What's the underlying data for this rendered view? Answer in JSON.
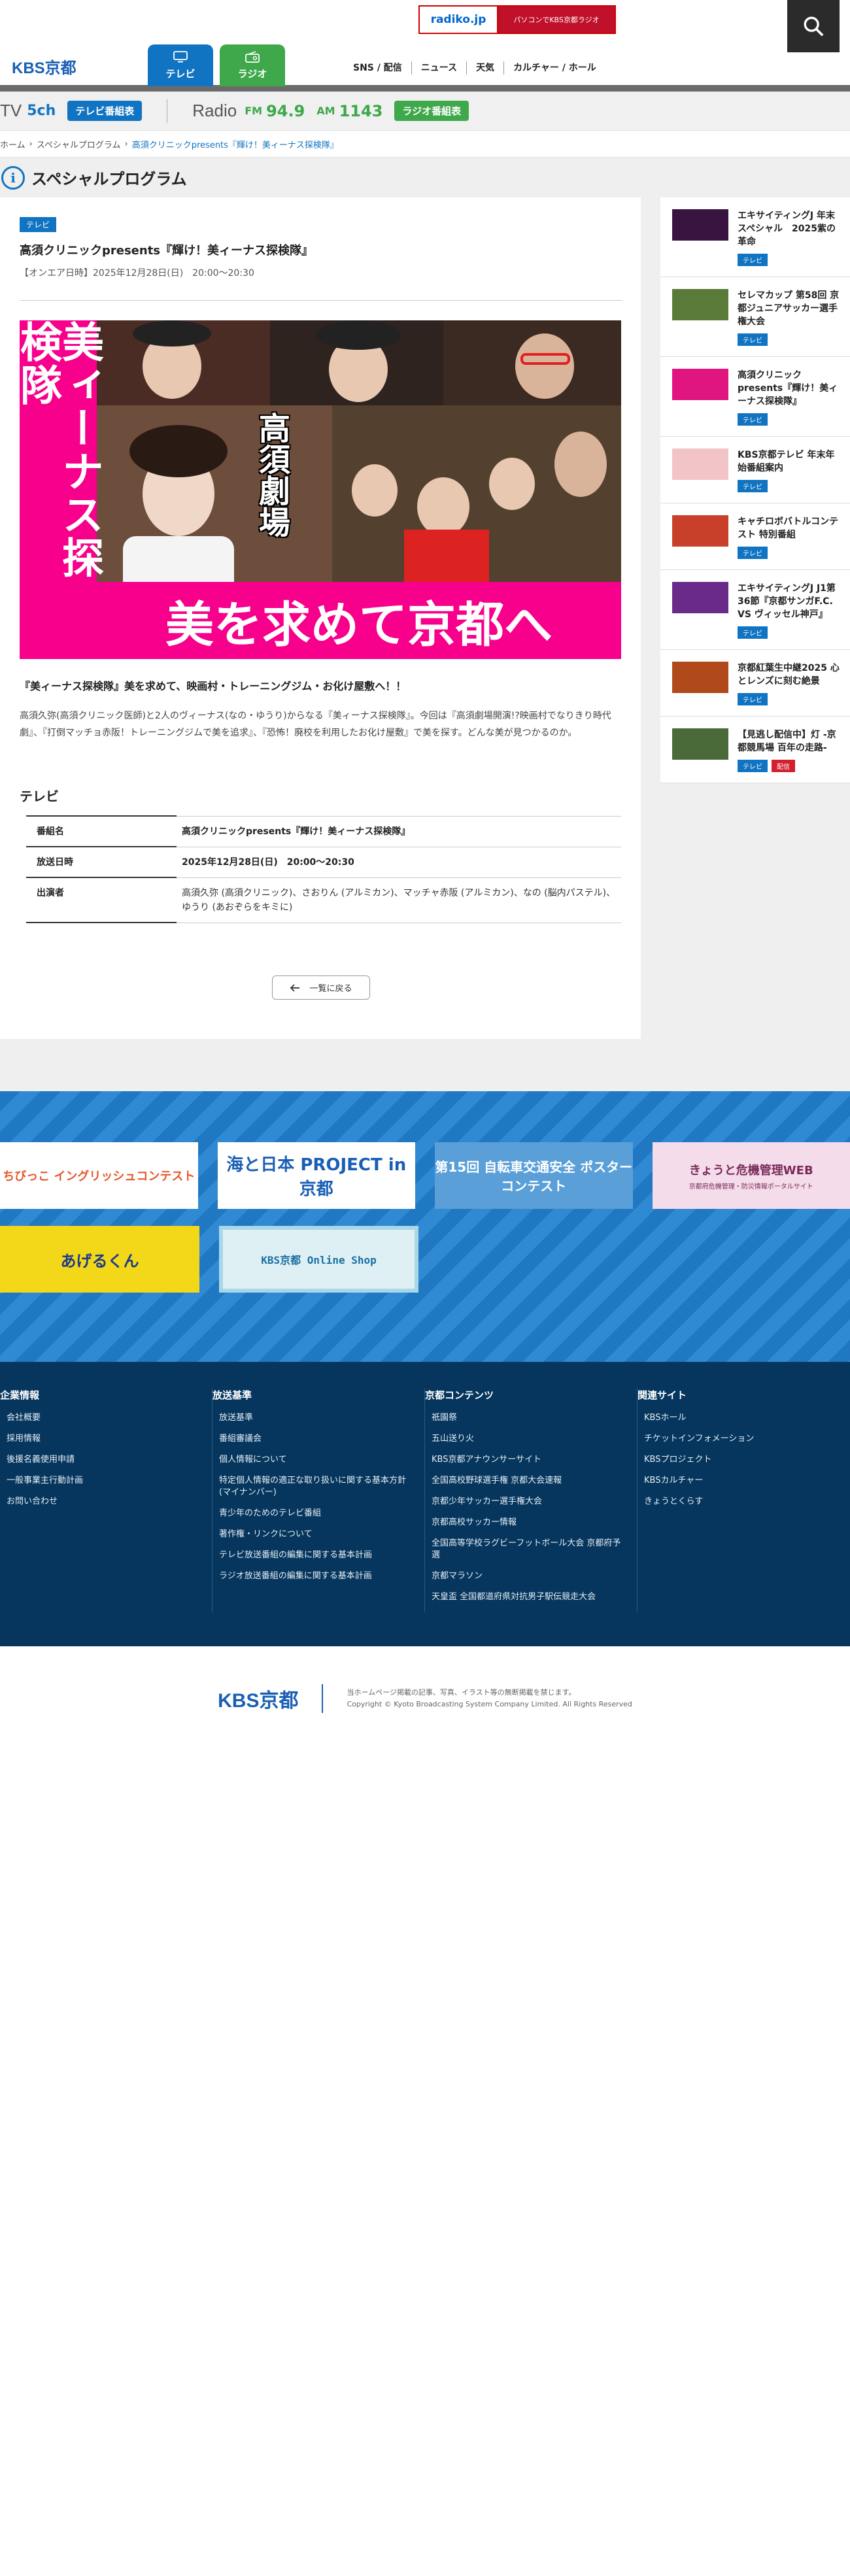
{
  "header": {
    "logo": "KBS京都",
    "radiko_logo": "radiko.jp",
    "radiko_text": "パソコンでKBS京都ラジオ",
    "tab_tv": "テレビ",
    "tab_radio": "ラジオ",
    "nav": [
      "SNS / 配信",
      "ニュース",
      "天気",
      "カルチャー / ホール"
    ]
  },
  "channel": {
    "tv_label": "TV",
    "tv_num": "5ch",
    "tv_btn": "テレビ番組表",
    "radio_label": "Radio",
    "fm": "FM",
    "fm_num": "94.9",
    "am": "AM",
    "am_num": "1143",
    "radio_btn": "ラジオ番組表"
  },
  "breadcrumb": [
    "ホーム",
    "スペシャルプログラム",
    "高須クリニックpresents『輝け！美ィーナス探検隊』"
  ],
  "section_title": "スペシャルプログラム",
  "article": {
    "tag": "テレビ",
    "title": "高須クリニックpresents『輝け！美ィーナス探検隊』",
    "date": "【オンエア日時】2025年12月28日(日)　20:00〜20:30",
    "hero_vertical": "美ィーナス探検隊",
    "hero_bottom": "美を求めて京都へ",
    "hero_seal": "高須劇場",
    "lead": "『美ィーナス探検隊』美を求めて、映画村・トレーニングジム・お化け屋敷へ！！",
    "desc": "高須久弥(高須クリニック医師)と2人のヴィーナス(なの・ゆうり)からなる『美ィーナス探検隊』。今回は『高須劇場開演!?映画村でなりきり時代劇』、『打倒マッチョ赤阪！トレーニングジムで美を追求』、『恐怖！廃校を利用したお化け屋敷』で美を探す。どんな美が見つかるのか。",
    "section": "テレビ",
    "table": [
      {
        "k": "番組名",
        "v": "高須クリニックpresents『輝け！美ィーナス探検隊』"
      },
      {
        "k": "放送日時",
        "v": "2025年12月28日(日)　20:00〜20:30"
      },
      {
        "k": "出演者",
        "v": "高須久弥 (高須クリニック)、さおりん (アルミカン)、マッチャ赤阪 (アルミカン)、なの (脳内パステル)、ゆうり (あおぞらをキミに)"
      }
    ],
    "back": "一覧に戻る"
  },
  "sidebar": [
    {
      "title": "エキサイティングJ 年末スペシャル　2025紫の革命",
      "tags": [
        "テレビ"
      ],
      "color": "#3a1440"
    },
    {
      "title": "セレマカップ 第58回 京都ジュニアサッカー選手権大会",
      "tags": [
        "テレビ"
      ],
      "color": "#5a7a3a"
    },
    {
      "title": "高須クリニックpresents『輝け！美ィーナス探検隊』",
      "tags": [
        "テレビ"
      ],
      "color": "#e0157f"
    },
    {
      "title": "KBS京都テレビ 年末年始番組案内",
      "tags": [
        "テレビ"
      ],
      "color": "#f2c4c8"
    },
    {
      "title": "キャチロボバトルコンテスト 特別番組",
      "tags": [
        "テレビ"
      ],
      "color": "#c8402a"
    },
    {
      "title": "エキサイティングJ J1第36節『京都サンガF.C. VS ヴィッセル神戸』",
      "tags": [
        "テレビ"
      ],
      "color": "#6a2a8a"
    },
    {
      "title": "京都紅葉生中継2025 心とレンズに刻む絶景",
      "tags": [
        "テレビ"
      ],
      "color": "#b04a1a"
    },
    {
      "title": "【見逃し配信中】灯 -京都競馬場 百年の走路-",
      "tags": [
        "テレビ",
        "配信"
      ],
      "color": "#4a6a3a"
    }
  ],
  "banners": {
    "b1": "ちびっこ イングリッシュコンテスト",
    "b2": "海と日本 PROJECT in 京都",
    "b3": "第15回 自転車交通安全 ポスターコンテスト",
    "b4": "きょうと危機管理WEB",
    "b4_sub": "京都府危機管理・防災情報ポータルサイト",
    "b5": "あげるくん",
    "b6": "KBS京都 Online Shop"
  },
  "footer_links": [
    {
      "head": "企業情報",
      "items": [
        "会社概要",
        "採用情報",
        "後援名義使用申請",
        "一般事業主行動計画",
        "お問い合わせ"
      ]
    },
    {
      "head": "放送基準",
      "items": [
        "放送基準",
        "番組審議会",
        "個人情報について",
        "特定個人情報の適正な取り扱いに関する基本方針(マイナンバー)",
        "青少年のためのテレビ番組",
        "著作権・リンクについて",
        "テレビ放送番組の編集に関する基本計画",
        "ラジオ放送番組の編集に関する基本計画"
      ]
    },
    {
      "head": "京都コンテンツ",
      "items": [
        "祇園祭",
        "五山送り火",
        "KBS京都アナウンサーサイト",
        "全国高校野球選手権 京都大会速報",
        "京都少年サッカー選手権大会",
        "京都高校サッカー情報",
        "全国高等学校ラグビーフットボール大会 京都府予選",
        "京都マラソン",
        "天皇盃 全国都道府県対抗男子駅伝競走大会"
      ]
    },
    {
      "head": "関連サイト",
      "items": [
        "KBSホール",
        "チケットインフォメーション",
        "KBSプロジェクト",
        "KBSカルチャー",
        "きょうとくらす"
      ]
    }
  ],
  "footer": {
    "logo": "KBS京都",
    "notice": "当ホームページ掲載の記事、写真、イラスト等の無断掲載を禁じます。",
    "copyright": "Copyright © Kyoto Broadcasting System Company Limited. All Rights Reserved"
  }
}
